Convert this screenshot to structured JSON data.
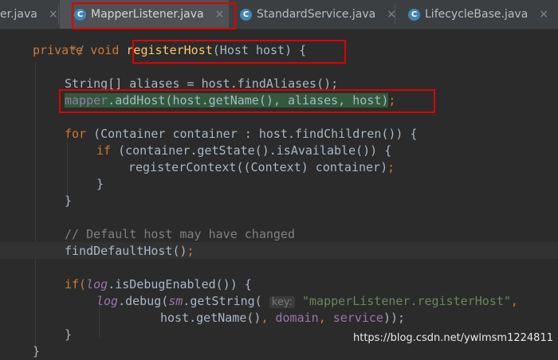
{
  "tabs": [
    {
      "label": "er.java",
      "icon": "",
      "active": false
    },
    {
      "label": "MapperListener.java",
      "icon": "C",
      "active": true
    },
    {
      "label": "StandardService.java",
      "icon": "C",
      "active": false
    },
    {
      "label": "LifecycleBase.java",
      "icon": "C",
      "active": false
    }
  ],
  "close_glyph": "×",
  "code": {
    "l1": "*/",
    "l2_kw1": "private",
    "l2_kw2": "void",
    "l2_fn": "registerHost",
    "l2_rest": "(Host host) {",
    "l3": "String[] aliases = host.findAliases();",
    "l4_field": "mapper",
    "l4_rest": ".addHost(host.getName(), aliases, host)",
    "semi": ";",
    "l5_kw": "for",
    "l5_rest": " (Container container : host.findChildren()) {",
    "l6_kw": "if",
    "l6_rest": " (container.getState().isAvailable()) {",
    "l7": "registerContext((Context) container)",
    "brace": "}",
    "l9": "// Default host may have changed",
    "l10": "findDefaultHost()",
    "l11_kw": "if(",
    "l11_field": "log",
    "l11_rest": ".isDebugEnabled()) {",
    "l12_field1": "log",
    "l12_mid": ".debug(",
    "l12_field2": "sm",
    "l12_mid2": ".getString( ",
    "l12_hint": "key:",
    "l12_str": " \"mapperListener.registerHost\"",
    "comma": ",",
    "l13_a": "host.getName()",
    "l13_domain": "domain",
    "l13_service": "service",
    "l13_end": "));"
  },
  "watermark": "https://blog.csdn.net/ywlmsm1224811",
  "colors": {
    "keyword": "#cc7832",
    "method": "#ffc66d",
    "field": "#9876aa",
    "string": "#6a8759",
    "comment": "#808080",
    "highlight_box": "#e00000"
  }
}
